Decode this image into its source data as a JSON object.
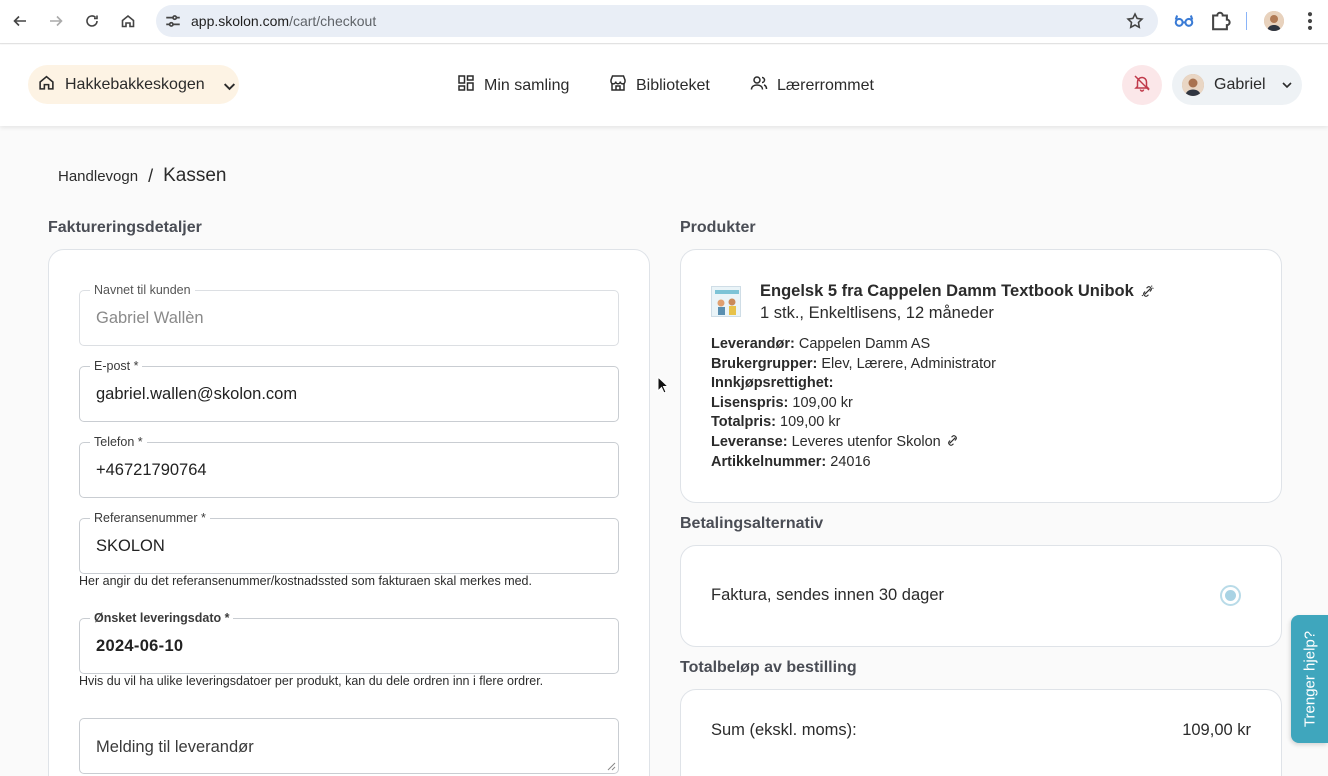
{
  "browser": {
    "url_host": "app.skolon.com",
    "url_path": "/cart/checkout"
  },
  "header": {
    "school": "Hakkebakkeskogen",
    "nav": [
      {
        "label": "Min samling",
        "icon": "grid-icon"
      },
      {
        "label": "Biblioteket",
        "icon": "store-icon"
      },
      {
        "label": "Lærerrommet",
        "icon": "users-icon"
      }
    ],
    "user": "Gabriel"
  },
  "breadcrumb": {
    "parent": "Handlevogn",
    "separator": "/",
    "current": "Kassen"
  },
  "billing": {
    "title": "Faktureringsdetaljer",
    "customer_name": {
      "label": "Navnet til kunden",
      "value": "Gabriel Wallèn"
    },
    "email": {
      "label": "E-post *",
      "value": "gabriel.wallen@skolon.com"
    },
    "phone": {
      "label": "Telefon *",
      "value": "+46721790764"
    },
    "reference": {
      "label": "Referansenummer *",
      "value": "SKOLON",
      "helper": "Her angir du det referansenummer/kostnadssted som fakturaen skal merkes med."
    },
    "delivery_date": {
      "label": "Ønsket leveringsdato *",
      "value": "2024-06-10",
      "helper": "Hvis du vil ha ulike leveringsdatoer per produkt, kan du dele ordren inn i flere ordrer."
    },
    "message": {
      "placeholder": "Melding til leverandør"
    }
  },
  "products": {
    "title": "Produkter",
    "item": {
      "name": "Engelsk 5 fra Cappelen Damm Textbook Unibok",
      "subtitle": "1 stk., Enkeltlisens, 12 måneder",
      "supplier_label": "Leverandør:",
      "supplier": "Cappelen Damm AS",
      "usergroups_label": "Brukergrupper:",
      "usergroups": "Elev, Lærere, Administrator",
      "purchase_label": "Innkjøpsrettighet:",
      "license_price_label": "Lisenspris:",
      "license_price": "109,00 kr",
      "total_price_label": "Totalpris:",
      "total_price": "109,00 kr",
      "delivery_label": "Leveranse:",
      "delivery": "Leveres utenfor Skolon",
      "article_label": "Artikkelnummer:",
      "article": "24016"
    }
  },
  "payment": {
    "title": "Betalingsalternativ",
    "option": "Faktura, sendes innen 30 dager"
  },
  "total": {
    "title": "Totalbeløp av bestilling",
    "sum_label": "Sum (ekskl. moms):",
    "sum_value": "109,00 kr"
  },
  "help_tab": "Trenger hjelp?",
  "colors": {
    "accent": "#3fa6bd",
    "school_pill": "#fdf3e4",
    "bell_bg": "#fbe7e9"
  }
}
